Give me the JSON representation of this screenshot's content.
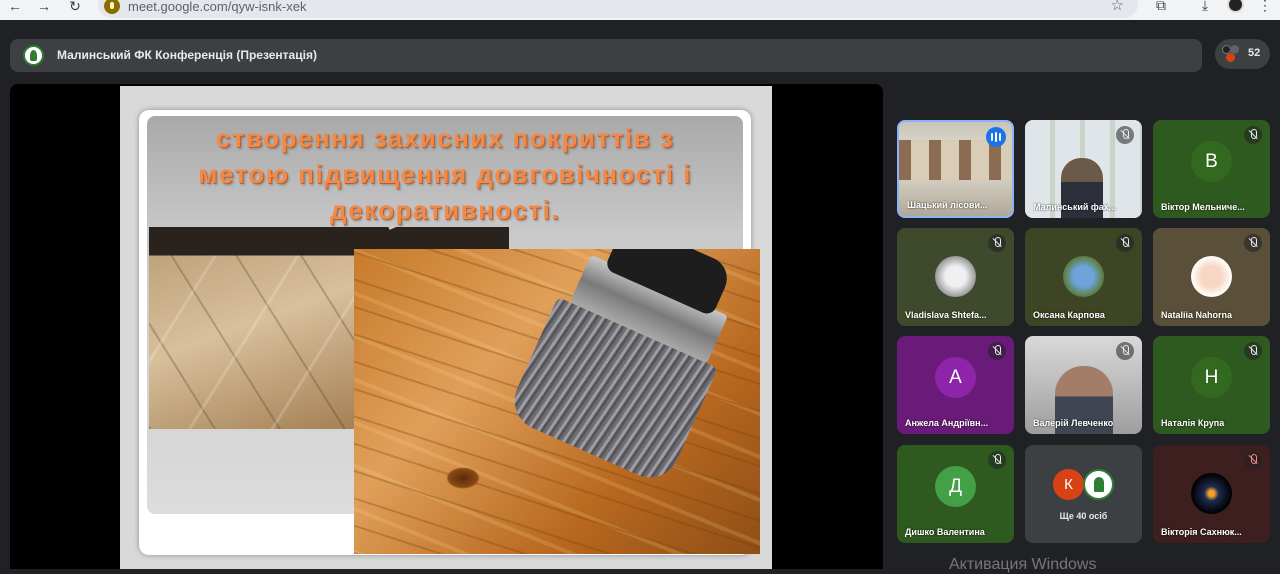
{
  "browser": {
    "url": "meet.google.com/qyw-isnk-xek",
    "back_glyph": "←",
    "forward_glyph": "→",
    "reload_glyph": "↻",
    "star_glyph": "☆",
    "extensions_glyph": "⧉",
    "download_glyph": "⤓",
    "menu_glyph": "⋮"
  },
  "meeting": {
    "title": "Малинський ФК Конференція (Презентація)",
    "participant_count": "52"
  },
  "slide": {
    "heading_line1": "створення захисних покриттів з",
    "heading_line2": "метою підвищення довговічності і",
    "heading_line3": "декоративності."
  },
  "participants": [
    {
      "name": "Шацький лісови...",
      "muted": false,
      "speaking": true,
      "type": "video"
    },
    {
      "name": "Малинський фах...",
      "muted": true,
      "type": "video"
    },
    {
      "name": "Віктор Мельниче...",
      "muted": true,
      "type": "letter",
      "initial": "В",
      "tile_color": "#2f5a1f",
      "avatar_color": "#33691e"
    },
    {
      "name": "Vladislava Shtefa...",
      "muted": true,
      "type": "photo",
      "tile_color": "#3f4a2c"
    },
    {
      "name": "Оксана Карпова",
      "muted": true,
      "type": "photo",
      "tile_color": "#3d4524"
    },
    {
      "name": "Nataliia Nahorna",
      "muted": true,
      "type": "photo",
      "tile_color": "#5a4f38"
    },
    {
      "name": "Анжела Андріївн...",
      "muted": true,
      "type": "letter",
      "initial": "А",
      "tile_color": "#6a1b7a",
      "avatar_color": "#8e24aa"
    },
    {
      "name": "Валерій Левченко",
      "muted": true,
      "type": "video"
    },
    {
      "name": "Наталія Крупа",
      "muted": true,
      "type": "letter",
      "initial": "Н",
      "tile_color": "#2f5a1f",
      "avatar_color": "#33691e"
    },
    {
      "name": "Дишко Валентина",
      "muted": true,
      "type": "letter",
      "initial": "Д",
      "tile_color": "#2f5a1f",
      "avatar_color": "#43a047"
    },
    {
      "name": "Вікторія Сахнюк...",
      "muted": true,
      "muted_red": true,
      "type": "photo",
      "tile_color": "#3d1f1f"
    }
  ],
  "more_tile": {
    "label": "Ще 40 осіб",
    "initial": "К",
    "avatar_color": "#d84315"
  },
  "watermark": "Активация Windows"
}
